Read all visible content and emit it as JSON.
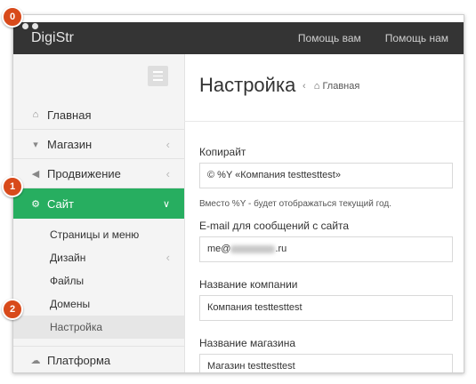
{
  "app": {
    "brand": "DigiStr"
  },
  "topnav": [
    "Помощь вам",
    "Помощь нам"
  ],
  "sidebar": {
    "items": [
      {
        "label": "Главная",
        "icon": "home-icon"
      },
      {
        "label": "Магазин",
        "icon": "cart-icon"
      },
      {
        "label": "Продвижение",
        "icon": "megaphone-icon"
      },
      {
        "label": "Сайт",
        "icon": "gears-icon"
      }
    ],
    "subitems": [
      {
        "label": "Страницы и меню"
      },
      {
        "label": "Дизайн"
      },
      {
        "label": "Файлы"
      },
      {
        "label": "Домены"
      },
      {
        "label": "Настройка"
      }
    ],
    "platform": {
      "label": "Платформа",
      "icon": "cloud-icon"
    }
  },
  "main": {
    "title": "Настройка",
    "breadcrumb": "Главная",
    "copyright_label": "Копирайт",
    "copyright_value": "© %Y «Компания testtesttest»",
    "copyright_hint": "Вместо %Y - будет отображаться текущий год.",
    "email_label": "E-mail для сообщений с сайта",
    "email_prefix": "me@",
    "email_suffix": ".ru",
    "company_label": "Название компании",
    "company_value": "Компания testtesttest",
    "shop_label": "Название магазина",
    "shop_value": "Магазин testtesttest"
  },
  "annotations": [
    "0",
    "1",
    "2"
  ],
  "colors": {
    "accent": "#27ae60",
    "topbar": "#343434",
    "badge": "#d84a1b"
  }
}
